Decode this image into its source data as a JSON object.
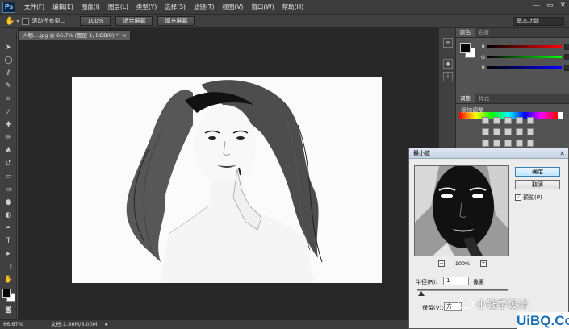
{
  "app": {
    "logo": "Ps"
  },
  "menu": [
    "文件(F)",
    "编辑(E)",
    "图像(I)",
    "图层(L)",
    "类型(Y)",
    "选择(S)",
    "滤镜(T)",
    "视图(V)",
    "窗口(W)",
    "帮助(H)"
  ],
  "window_controls": {
    "minimize": "—",
    "maximize": "▭",
    "close": "✕"
  },
  "options_bar": {
    "scroll_all_label": "滚动所有窗口",
    "zoom_100_label": "100%",
    "fit_screen_label": "适合屏幕",
    "fill_screen_label": "填充屏幕",
    "workspace": "基本功能"
  },
  "document": {
    "tab_title": "人物....jpg @ 66.7% (图层 1, RGB/8) *",
    "tab_close": "×"
  },
  "status": {
    "zoom": "66.67%",
    "doc_info": "文档:2.86M/8.00M"
  },
  "panels": {
    "color_tabs": [
      "颜色",
      "色板"
    ],
    "channels": [
      "R",
      "G",
      "B"
    ],
    "adjust_tabs": [
      "调整",
      "样式"
    ],
    "adjust_heading": "添加调整"
  },
  "dialog": {
    "title": "最小值",
    "close": "✕",
    "ok_label": "确定",
    "cancel_label": "取消",
    "preview_label": "预览(P)",
    "zoom_level": "100%",
    "zoom_out": "−",
    "zoom_in": "+",
    "radius_label": "半径(R):",
    "radius_value": "1",
    "radius_unit": "像素",
    "preserve_label": "保留(V):",
    "preserve_value": "方"
  },
  "watermark": {
    "cn": "小钱学设计",
    "en": "UiBQ.CoM"
  },
  "colors": {
    "accent_blue": "#1b6fb8",
    "menu_bg": "#3c3c3c",
    "doc_bg": "#282828"
  }
}
